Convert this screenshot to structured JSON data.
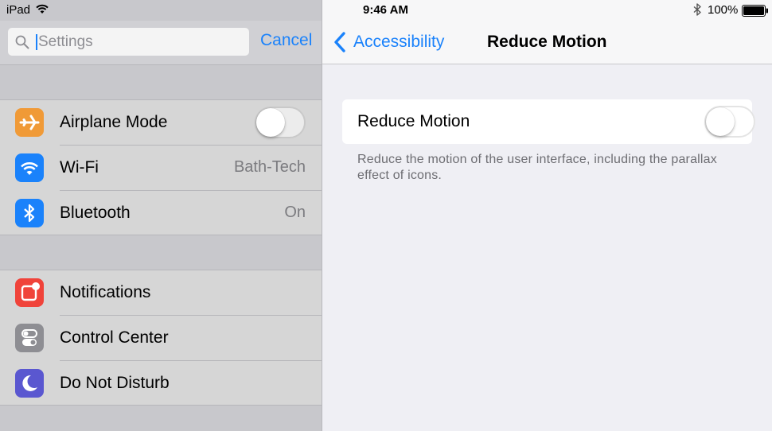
{
  "status_bar": {
    "carrier": "iPad",
    "time": "9:46 AM",
    "battery_percent": "100%",
    "icons": [
      "wifi-icon",
      "bluetooth-icon",
      "battery-icon"
    ]
  },
  "master": {
    "search": {
      "placeholder": "Settings",
      "value": "",
      "cancel_label": "Cancel"
    },
    "groups": [
      {
        "rows": [
          {
            "label": "Airplane Mode",
            "icon": "airplane-icon",
            "icon_color": "#f09a37",
            "toggle_on": false
          },
          {
            "label": "Wi-Fi",
            "value": "Bath-Tech",
            "icon": "wifi-icon",
            "icon_color": "#1a82fb"
          },
          {
            "label": "Bluetooth",
            "value": "On",
            "icon": "bluetooth-icon",
            "icon_color": "#1a82fb"
          }
        ]
      },
      {
        "rows": [
          {
            "label": "Notifications",
            "icon": "notifications-icon",
            "icon_color": "#f0433a"
          },
          {
            "label": "Control Center",
            "icon": "control-center-icon",
            "icon_color": "#8e8e93"
          },
          {
            "label": "Do Not Disturb",
            "icon": "moon-icon",
            "icon_color": "#5a57d0"
          }
        ]
      }
    ]
  },
  "detail": {
    "back_label": "Accessibility",
    "title": "Reduce Motion",
    "setting": {
      "label": "Reduce Motion",
      "toggle_on": false
    },
    "footer": "Reduce the motion of the user interface, including the parallax effect of icons."
  },
  "colors": {
    "accent": "#1a82fb",
    "master_dim_bg": "#c8c8cc",
    "detail_bg": "#efeff4"
  }
}
